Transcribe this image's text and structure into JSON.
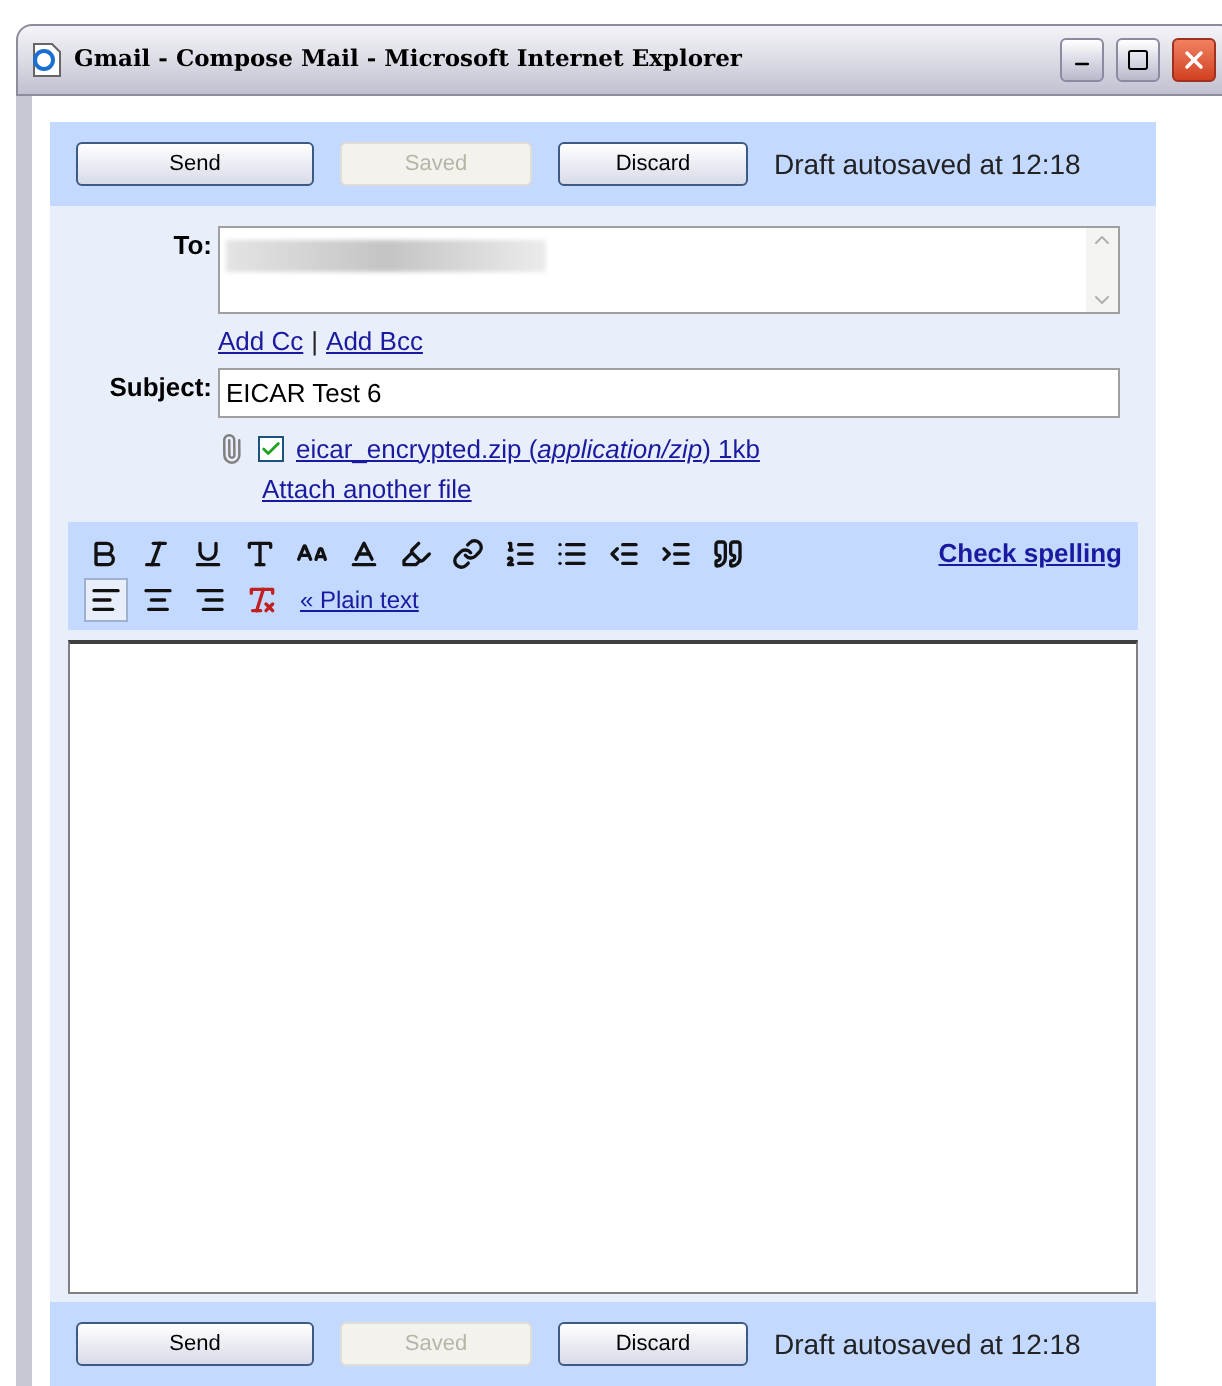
{
  "window": {
    "title": "Gmail - Compose Mail - Microsoft Internet Explorer"
  },
  "top_bar": {
    "buttons": [
      {
        "label": "Send",
        "disabled": false
      },
      {
        "label": "Saved",
        "disabled": true
      },
      {
        "label": "Discard",
        "disabled": false
      }
    ],
    "status": "Draft autosaved at 12:18"
  },
  "to": {
    "label": "To:"
  },
  "cc_links": [
    "Add Cc",
    "|",
    "Add Bcc"
  ],
  "subject": {
    "label": "Subject:",
    "value": "EICAR Test 6"
  },
  "attachment": {
    "checked": true,
    "text": "eicar_encrypted.zip (*application/zip*) 1kb"
  },
  "attach_another": "Attach another file",
  "toolbar": {
    "format_buttons": [
      {
        "kind": "bold"
      },
      {
        "kind": "italic"
      },
      {
        "kind": "underline"
      },
      {
        "kind": "font"
      },
      {
        "kind": "size"
      },
      {
        "kind": "text-color"
      },
      {
        "kind": "highlight"
      },
      {
        "kind": "link"
      },
      {
        "kind": "numbered-list"
      },
      {
        "kind": "bullet-list"
      },
      {
        "kind": "outdent"
      },
      {
        "kind": "indent"
      },
      {
        "kind": "quote"
      }
    ],
    "align_buttons": [
      {
        "kind": "left",
        "selected": true
      },
      {
        "kind": "center",
        "selected": false
      },
      {
        "kind": "right",
        "selected": false
      },
      {
        "kind": "remove-format"
      }
    ],
    "check_spelling": "Check spelling",
    "plain_text": "« Plain text"
  },
  "bottom_bar": {
    "buttons": [
      {
        "label": "Send",
        "disabled": false
      },
      {
        "label": "Saved",
        "disabled": true
      },
      {
        "label": "Discard",
        "disabled": false
      }
    ],
    "status": "Draft autosaved at 12:18"
  }
}
